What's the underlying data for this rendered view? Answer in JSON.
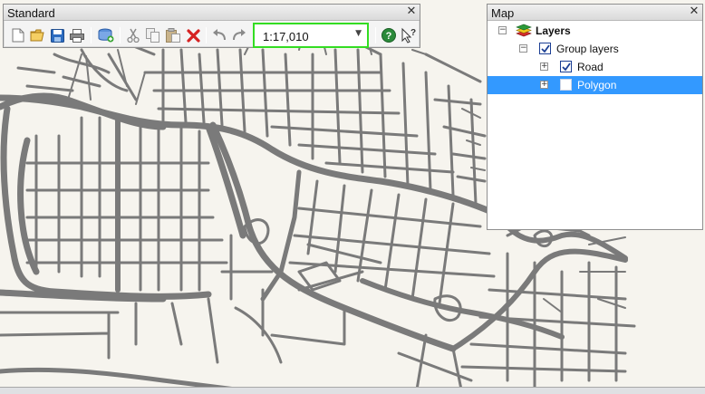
{
  "toolbar": {
    "title": "Standard",
    "scale_value": "1:17,010",
    "tools": [
      {
        "name": "new-icon"
      },
      {
        "name": "open-folder-icon"
      },
      {
        "name": "save-icon"
      },
      {
        "name": "print-icon"
      },
      {
        "name": "add-data-icon"
      },
      {
        "name": "cut-icon"
      },
      {
        "name": "copy-icon"
      },
      {
        "name": "paste-icon"
      },
      {
        "name": "delete-icon"
      },
      {
        "name": "undo-icon"
      },
      {
        "name": "redo-icon"
      },
      {
        "name": "help-icon"
      },
      {
        "name": "whats-this-icon"
      }
    ]
  },
  "map_panel": {
    "title": "Map",
    "tree": [
      {
        "label": "Layers",
        "level": 0,
        "checked": null,
        "expanded": true
      },
      {
        "label": "Group layers",
        "level": 1,
        "checked": true,
        "expanded": true
      },
      {
        "label": "Road",
        "level": 2,
        "checked": true,
        "expanded": false
      },
      {
        "label": "Polygon",
        "level": 2,
        "checked": false,
        "expanded": false,
        "selected": true
      }
    ]
  },
  "colors": {
    "map_background": "#f6f4ee",
    "road": "#7a7a7a",
    "scale_highlight": "#33dd22",
    "selection": "#3399ff"
  }
}
